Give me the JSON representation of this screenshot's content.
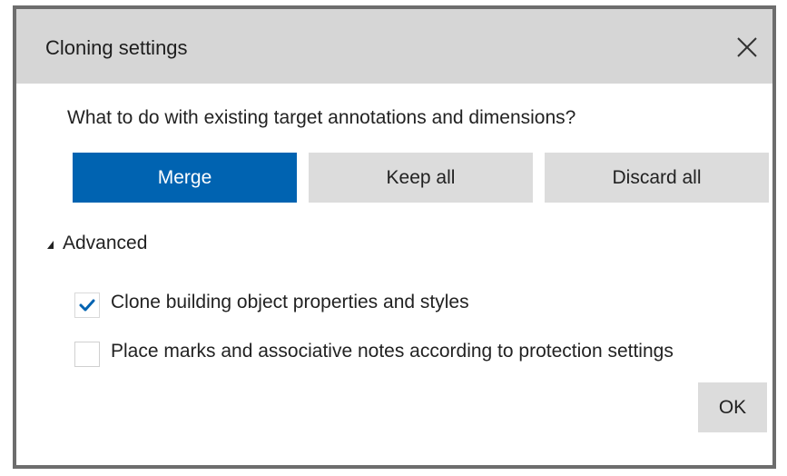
{
  "dialog": {
    "title": "Cloning settings",
    "close_icon": "close-icon",
    "question": "What to do with existing target annotations and dimensions?",
    "buttons": {
      "merge": "Merge",
      "keep_all": "Keep all",
      "discard_all": "Discard all"
    },
    "selected_button": "Merge",
    "advanced": {
      "label": "Advanced",
      "expanded": true,
      "options": [
        {
          "label": "Clone building object properties and styles",
          "checked": true
        },
        {
          "label": "Place marks and associative notes according to protection settings",
          "checked": false
        }
      ]
    },
    "ok_label": "OK"
  },
  "colors": {
    "accent": "#0063b1",
    "button_bg": "#dcdcdc",
    "titlebar_bg": "#d6d6d6",
    "check_color": "#0063b1"
  }
}
